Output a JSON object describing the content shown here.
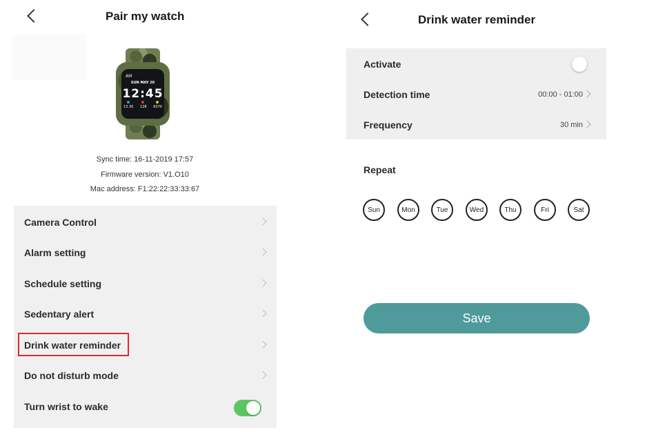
{
  "left_screen": {
    "title": "Pair my watch",
    "watch_display": {
      "am": "AM",
      "date": "SUN MAY 20",
      "time": "12:45",
      "stats": [
        "13.30",
        "128",
        "6370"
      ]
    },
    "info": {
      "sync": "Sync time: 16-11-2019 17:57",
      "firmware": "Firmware version: V1.O10",
      "mac": "Mac address: F1:22:22:33:33:67"
    },
    "menu": [
      {
        "label": "Camera Control"
      },
      {
        "label": "Alarm setting"
      },
      {
        "label": "Schedule setting"
      },
      {
        "label": "Sedentary alert"
      },
      {
        "label": "Drink water reminder",
        "highlighted": true
      },
      {
        "label": "Do not disturb mode"
      },
      {
        "label": "Turn wrist to wake",
        "toggle": "on"
      }
    ]
  },
  "right_screen": {
    "title": "Drink water reminder",
    "activate": {
      "label": "Activate",
      "toggle": "off"
    },
    "detection_time": {
      "label": "Detection time",
      "value": "00:00 - 01:00"
    },
    "frequency": {
      "label": "Frequency",
      "value": "30 min"
    },
    "repeat_label": "Repeat",
    "days": [
      "Sun",
      "Mon",
      "Tue",
      "Wed",
      "Thu",
      "Fri",
      "Sat"
    ],
    "save_label": "Save"
  },
  "colors": {
    "accent_teal": "#4f9a9a",
    "toggle_green": "#5dc562",
    "highlight_red": "#e0282d",
    "panel_gray": "#f0f0f0"
  },
  "icons": [
    "back-arrow-icon",
    "chevron-right-icon",
    "toggle-switch"
  ]
}
